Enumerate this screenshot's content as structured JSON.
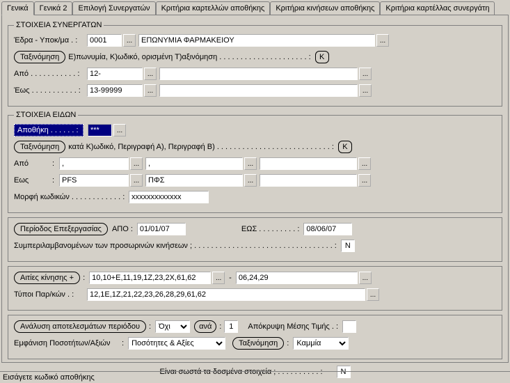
{
  "tabs": {
    "t0": "Γενικά",
    "t1": "Γενικά 2",
    "t2": "Επιλογή Συνεργατών",
    "t3": "Κριτήρια καρτελλών αποθήκης",
    "t4": "Κριτήρια κινήσεων αποθήκης",
    "t5": "Κριτήρια καρτέλλας συνεργάτη"
  },
  "partners": {
    "legend": "ΣΤΟΙΧΕΙΑ ΣΥΝΕΡΓΑΤΩΝ",
    "edra_label": "Έδρα - Υποκ/μα  .   :",
    "edra_code": "0001",
    "edra_name": "ΕΠΩΝΥΜΙΑ ΦΑΡΜΑΚΕΙΟΥ",
    "sort_btn": "Ταξινόμηση",
    "sort_text": "Ε)πωνυμία, Κ)ωδικό, ορισμένη Τ)αξινόμηση . . . . . . . . . . . . . . . . . . . . . :",
    "sort_val": "Κ",
    "from_label": "Από . . . . . . . . . . . :",
    "from_val": "12-",
    "to_label": "Έως . . . . . . . . . . . :",
    "to_val": "13-99999"
  },
  "items": {
    "legend": "ΣΤΟΙΧΕΙΑ ΕΙΔΩΝ",
    "warehouse_label": "Αποθήκη . . . . . . :",
    "warehouse_val": "***",
    "sort_btn": "Ταξινόμηση",
    "sort_text": "κατά Κ)ωδικό,  Περιγραφή Α),  Περιγραφή Β) . . . . . . . . . . . . . . . . . . . . . . . . . . . :",
    "sort_val": "Κ",
    "from_label": "Από",
    "from_v1": ",",
    "from_v2": ",",
    "from_v3": "",
    "to_label": "Εως",
    "to_v1": "PFS",
    "to_v2": "ΠΦΣ",
    "to_v3": "",
    "format_label": "Μορφή κωδικών . . . . . . . . . . . . :",
    "format_val": "xxxxxxxxxxxxx"
  },
  "period": {
    "btn": "Περίοδος Επεξεργασίας",
    "from_label": "ΑΠΟ     :",
    "from_val": "01/01/07",
    "to_label": "ΕΩΣ . . . . . . . . . :",
    "to_val": "08/06/07",
    "temp_label": "Συμπεριλαμβανομένων των προσωρινών κινήσεων ; . . . . . . . . . . . . . . . . . . . . . . . . . . . . . . . . . :",
    "temp_val": "Ν"
  },
  "causes": {
    "btn": "Αιτίες κίνησης +",
    "v1": "10,10+E,11,19,1Ζ,23,2Χ,61,62",
    "v2": "06,24,29",
    "types_label": "Τύποι Παρ/κών  .  :",
    "types_val": "12,1Ε,1Ζ,21,22,23,26,28,29,61,62"
  },
  "analysis": {
    "btn": "Ανάλυση αποτελεσμάτων περιόδου",
    "v1": "Όχι",
    "per_label": "ανά",
    "per_val": "1",
    "hide_label": "Απόκρυψη Μέσης Τιμής .     :",
    "hide_val": "",
    "qty_label": "Εμφάνιση Ποσοτήτων/Αξιών",
    "qty_val": "Ποσότητες & Αξίες",
    "sort_btn": "Ταξινόμηση",
    "sort_val": "Καμμία"
  },
  "confirm": {
    "label": "Είναι σωστά τα δοσμένα στοιχεία ; . . . . . . . . . . :",
    "val": "Ν"
  },
  "status": "Εισάγετε κωδικό αποθήκης"
}
